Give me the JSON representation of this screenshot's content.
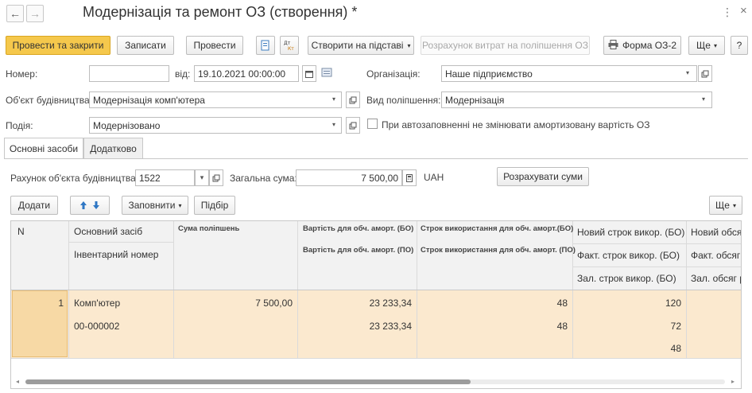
{
  "window": {
    "title": "Модернізація та ремонт ОЗ (створення) *",
    "more_icon": "⋮",
    "close_icon": "×"
  },
  "toolbar": {
    "post_close": "Провести та закрити",
    "save": "Записати",
    "post": "Провести",
    "create_based": "Створити на підставі",
    "calc_costs": "Розрахунок витрат на поліпшення ОЗ",
    "form_label": "Форма ОЗ-2",
    "more": "Ще",
    "help": "?"
  },
  "form": {
    "number_label": "Номер:",
    "number_value": "",
    "date_label": "від:",
    "date_value": "19.10.2021 00:00:00",
    "org_label": "Організація:",
    "org_value": "Наше підприємство",
    "object_label": "Об'єкт будівництва:",
    "object_value": "Модернізація комп'ютера",
    "improvement_label": "Вид поліпшення:",
    "improvement_value": "Модернізація",
    "event_label": "Подія:",
    "event_value": "Модернізовано",
    "autofill_label": "При автозаповненні не змінювати амортизовану вартість ОЗ"
  },
  "tabs": [
    "Основні засоби",
    "Додатково"
  ],
  "tab_content": {
    "account_label": "Рахунок об'єкта будівництва:",
    "account_value": "1522",
    "total_label": "Загальна сума:",
    "total_value": "7 500,00",
    "currency": "UAH",
    "calc_button": "Розрахувати суми",
    "add_button": "Додати",
    "fill_button": "Заповнити",
    "select_button": "Підбір",
    "more_button": "Ще"
  },
  "table": {
    "headers": {
      "n": "N",
      "asset": "Основний засіб",
      "inventory": "Інвентарний номер",
      "sum": "Сума поліпшень",
      "cost_bo": "Вартість для обч. аморт. (БО)",
      "cost_po": "Вартість для обч. аморт. (ПО)",
      "term_bo": "Строк використання для обч. аморт.(БО)",
      "term_po": "Строк використання для обч. аморт. (ПО)",
      "new_term": "Новий строк викор. (БО)",
      "fact_term": "Факт. строк викор. (БО)",
      "rem_term": "Зал. строк викор. (БО)",
      "new_volume": "Новий обсяг",
      "fact_volume": "Факт. обсяг р",
      "rem_volume": "Зал. обсяг ро"
    },
    "rows": [
      {
        "n": "1",
        "asset": "Комп'ютер",
        "inventory": "00-000002",
        "sum": "7 500,00",
        "cost_bo": "23 233,34",
        "cost_po": "23 233,34",
        "term_bo": "48",
        "term_po": "48",
        "new_term": "120",
        "fact_term": "72",
        "rem_term": "48"
      }
    ]
  }
}
